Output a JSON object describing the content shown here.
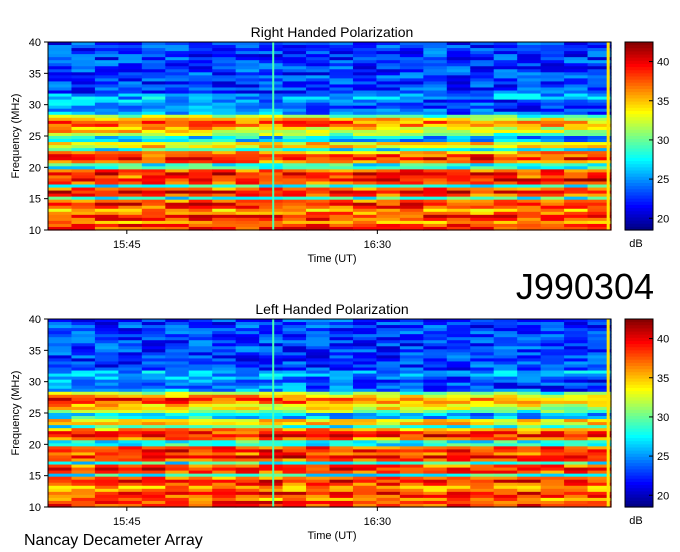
{
  "event_label": "J990304",
  "footer_label": "Nancay Decameter Array",
  "colors": {
    "colormap": [
      "#00007f",
      "#0000ff",
      "#007fff",
      "#00ffff",
      "#7fff7f",
      "#ffff00",
      "#ff7f00",
      "#ff0000",
      "#7f0000"
    ]
  },
  "chart_data": [
    {
      "type": "heatmap",
      "title": "Right Handed Polarization",
      "xlabel": "Time (UT)",
      "ylabel": "Frequency (MHz)",
      "x_ticks": [
        "15:45",
        "16:30"
      ],
      "y_ticks": [
        10,
        15,
        20,
        25,
        30,
        35,
        40
      ],
      "ylim": [
        10,
        40
      ],
      "colorbar": {
        "label": "dB",
        "ticks": [
          20,
          25,
          30,
          35,
          40
        ],
        "range": [
          18.5,
          42.5
        ]
      },
      "strong_bands_mhz": [
        10.5,
        12,
        14,
        16,
        18,
        19,
        21.5,
        27
      ]
    },
    {
      "type": "heatmap",
      "title": "Left Handed Polarization",
      "xlabel": "Time (UT)",
      "ylabel": "Frequency (MHz)",
      "x_ticks": [
        "15:45",
        "16:30"
      ],
      "y_ticks": [
        10,
        15,
        20,
        25,
        30,
        35,
        40
      ],
      "ylim": [
        10,
        40
      ],
      "colorbar": {
        "label": "dB",
        "ticks": [
          20,
          25,
          30,
          35,
          40
        ],
        "range": [
          18.5,
          42.5
        ]
      },
      "strong_bands_mhz": [
        10.5,
        12,
        14,
        16,
        18,
        19,
        21.5,
        27
      ]
    }
  ]
}
